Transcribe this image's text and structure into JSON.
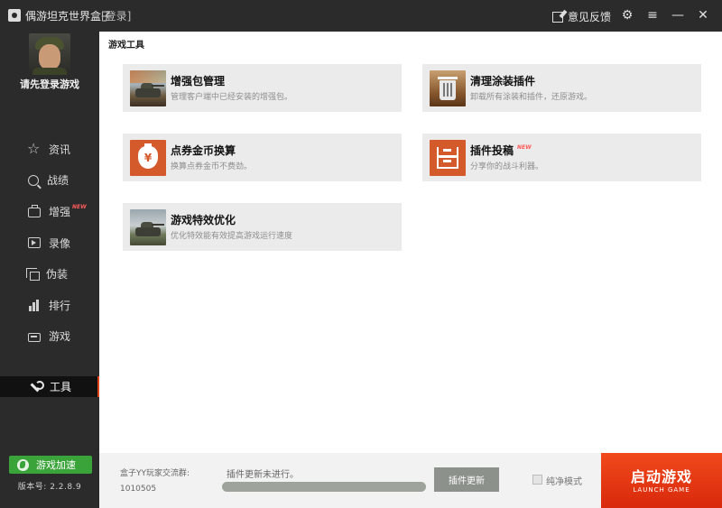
{
  "window": {
    "title": "偶游坦克世界盒子",
    "login_link": "[登录]",
    "feedback_label": "意见反馈",
    "buttons": [
      "settings-icon",
      "menu-icon",
      "minimize-icon",
      "close-icon"
    ]
  },
  "sidebar": {
    "login_prompt": "请先登录游戏",
    "items": [
      {
        "label": "资讯",
        "icon": "star-icon"
      },
      {
        "label": "战绩",
        "icon": "search-icon"
      },
      {
        "label": "增强",
        "icon": "toolbox-icon",
        "badge": "NEW"
      },
      {
        "label": "录像",
        "icon": "play-icon"
      },
      {
        "label": "伪装",
        "icon": "layers-icon"
      },
      {
        "label": "排行",
        "icon": "bar-chart-icon"
      },
      {
        "label": "游戏",
        "icon": "gamepad-icon"
      }
    ],
    "active_item": {
      "label": "工具",
      "icon": "wrench-icon"
    },
    "accelerate_label": "游戏加速",
    "version": "版本号: 2.2.8.9"
  },
  "main": {
    "section_title": "游戏工具",
    "cards": [
      {
        "title": "增强包管理",
        "desc": "管理客户端中已经安装的增强包。",
        "icon": "tank-icon"
      },
      {
        "title": "清理涂装插件",
        "desc": "卸载所有涂装和插件，还原游戏。",
        "icon": "trash-icon"
      },
      {
        "title": "点券金币换算",
        "desc": "换算点券金币不费劲。",
        "icon": "coin-bag-icon",
        "icon_text": "¥"
      },
      {
        "title": "插件投稿",
        "desc": "分享你的战斗利器。",
        "icon": "inbox-icon",
        "badge": "NEW"
      },
      {
        "title": "游戏特效优化",
        "desc": "优化特效能有效提高游戏运行速度",
        "icon": "tank-icon"
      }
    ]
  },
  "bottom": {
    "qq_label": "盒子YY玩家交流群:",
    "qq_number": "1010505",
    "update_status": "插件更新未进行。",
    "update_button": "插件更新",
    "pure_mode_label": "纯净模式",
    "launch_cn": "启动游戏",
    "launch_en": "LAUNCH GAME"
  },
  "colors": {
    "accent": "#e0431a",
    "sidebar_bg": "#2b2b2b",
    "card_bg": "#ebebeb",
    "accelerate": "#3aa43a",
    "launch": "#e8360f"
  }
}
